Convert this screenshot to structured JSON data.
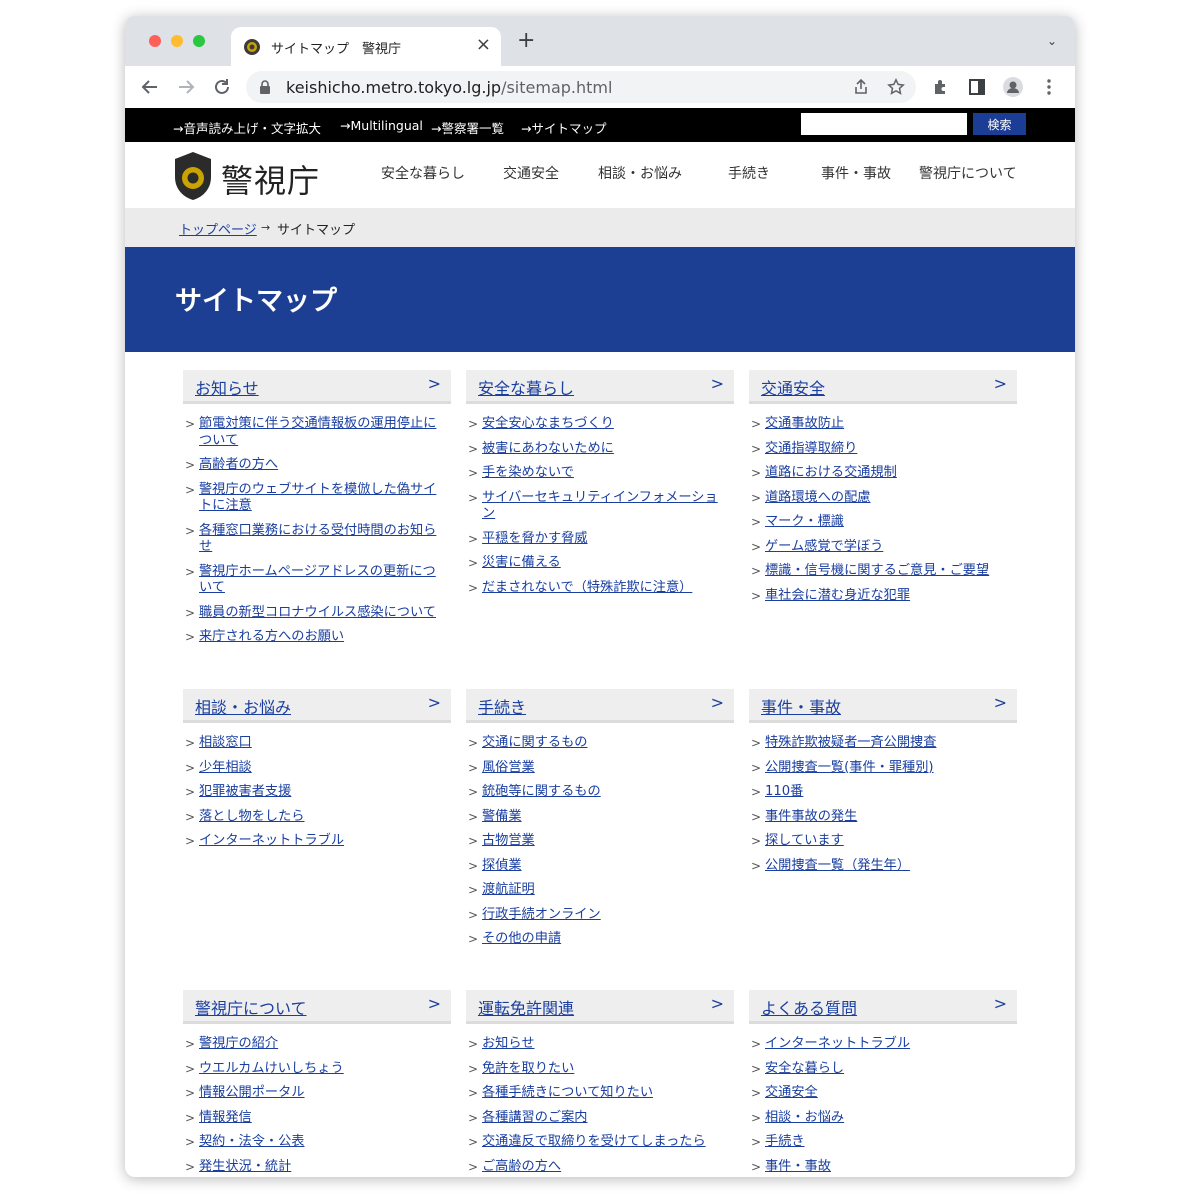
{
  "browser": {
    "tab_title": "サイトマップ　警視庁",
    "close": "×",
    "new_tab": "+",
    "tab_menu": "⌄",
    "url_host": "keishicho.metro.tokyo.lg.jp",
    "url_path": "/sitemap.html",
    "colors": {
      "red": "#ff5f57",
      "yellow": "#febc2e",
      "green": "#28c840"
    }
  },
  "utility": {
    "links": [
      "音声読み上げ・文字拡大",
      "Multilingual",
      "警察署一覧",
      "サイトマップ"
    ],
    "search_button": "検索"
  },
  "header": {
    "logo_text": "警視庁",
    "nav": [
      "安全な暮らし",
      "交通安全",
      "相談・お悩み",
      "手続き",
      "事件・事故",
      "警視庁について"
    ]
  },
  "breadcrumb": {
    "home": "トップページ",
    "separator": "→",
    "current": "サイトマップ"
  },
  "page_title": "サイトマップ",
  "sections": [
    {
      "title": "お知らせ",
      "items": [
        "節電対策に伴う交通情報板の運用停止について",
        "高齢者の方へ",
        "警視庁のウェブサイトを模倣した偽サイトに注意",
        "各種窓口業務における受付時間のお知らせ",
        "警視庁ホームページアドレスの更新について",
        "職員の新型コロナウイルス感染について",
        "来庁される方へのお願い"
      ]
    },
    {
      "title": "安全な暮らし",
      "items": [
        "安全安心なまちづくり",
        "被害にあわないために",
        "手を染めないで",
        "サイバーセキュリティインフォメーション",
        "平穏を脅かす脅威",
        "災害に備える",
        "だまされないで（特殊詐欺に注意）"
      ]
    },
    {
      "title": "交通安全",
      "items": [
        "交通事故防止",
        "交通指導取締り",
        "道路における交通規制",
        "道路環境への配慮",
        "マーク・標識",
        "ゲーム感覚で学ぼう",
        "標識・信号機に関するご意見・ご要望",
        "車社会に潜む身近な犯罪"
      ]
    },
    {
      "title": "相談・お悩み",
      "items": [
        "相談窓口",
        "少年相談",
        "犯罪被害者支援",
        "落とし物をしたら",
        "インターネットトラブル"
      ]
    },
    {
      "title": "手続き",
      "items": [
        "交通に関するもの",
        "風俗営業",
        "銃砲等に関するもの",
        "警備業",
        "古物営業",
        "探偵業",
        "渡航証明",
        "行政手続オンライン",
        "その他の申請"
      ]
    },
    {
      "title": "事件・事故",
      "items": [
        "特殊詐欺被疑者一斉公開捜査",
        "公開捜査一覧(事件・罪種別)",
        "110番",
        "事件事故の発生",
        "探しています",
        "公開捜査一覧（発生年）"
      ]
    },
    {
      "title": "警視庁について",
      "items": [
        "警視庁の紹介",
        "ウエルカムけいしちょう",
        "情報公開ポータル",
        "情報発信",
        "契約・法令・公表",
        "発生状況・統計"
      ]
    },
    {
      "title": "運転免許関連",
      "items": [
        "お知らせ",
        "免許を取りたい",
        "各種手続きについて知りたい",
        "各種講習のご案内",
        "交通違反で取締りを受けてしまったら",
        "ご高齢の方へ"
      ]
    },
    {
      "title": "よくある質問",
      "items": [
        "インターネットトラブル",
        "安全な暮らし",
        "交通安全",
        "相談・お悩み",
        "手続き",
        "事件・事故"
      ]
    }
  ]
}
